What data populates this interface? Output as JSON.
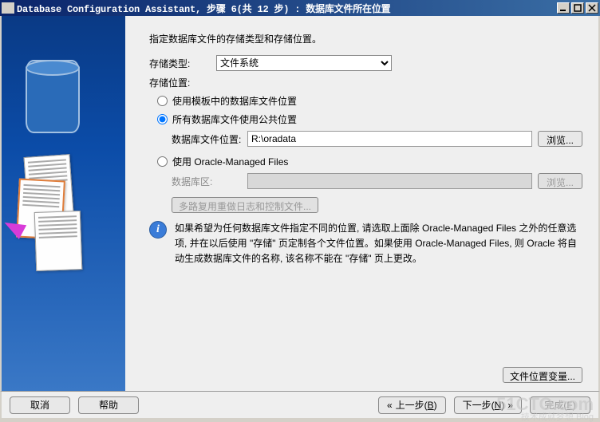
{
  "window": {
    "title": "Database Configuration Assistant, 步骤 6(共 12 步) : 数据库文件所在位置"
  },
  "main": {
    "description": "指定数据库文件的存储类型和存储位置。",
    "storage_type_label": "存储类型:",
    "storage_type_value": "文件系统",
    "storage_location_label": "存储位置:",
    "radios": {
      "r1": "使用模板中的数据库文件位置",
      "r2": "所有数据库文件使用公共位置",
      "r2_field_label": "数据库文件位置:",
      "r2_field_value": "R:\\oradata",
      "r2_browse": "浏览...",
      "r3": "使用 Oracle-Managed Files",
      "r3_field_label": "数据库区:",
      "r3_field_value": "",
      "r3_browse": "浏览...",
      "r3_multiplex": "多路复用重做日志和控制文件..."
    },
    "info_text": "如果希望为任何数据库文件指定不同的位置, 请选取上面除 Oracle-Managed Files 之外的任意选项, 并在以后使用 \"存储\" 页定制各个文件位置。如果使用 Oracle-Managed Files, 则 Oracle 将自动生成数据库文件的名称, 该名称不能在 \"存储\" 页上更改。",
    "file_location_vars": "文件位置变量..."
  },
  "footer": {
    "cancel": "取消",
    "help": "帮助",
    "back_pre": "上一步(",
    "back_hot": "B",
    "back_post": ")",
    "next_pre": "下一步(",
    "next_hot": "N",
    "next_post": ")",
    "finish_pre": "完成(",
    "finish_hot": "F",
    "finish_post": ")"
  },
  "watermark": {
    "big": "51CTO.com",
    "small": "技术成就梦想 Blog"
  }
}
